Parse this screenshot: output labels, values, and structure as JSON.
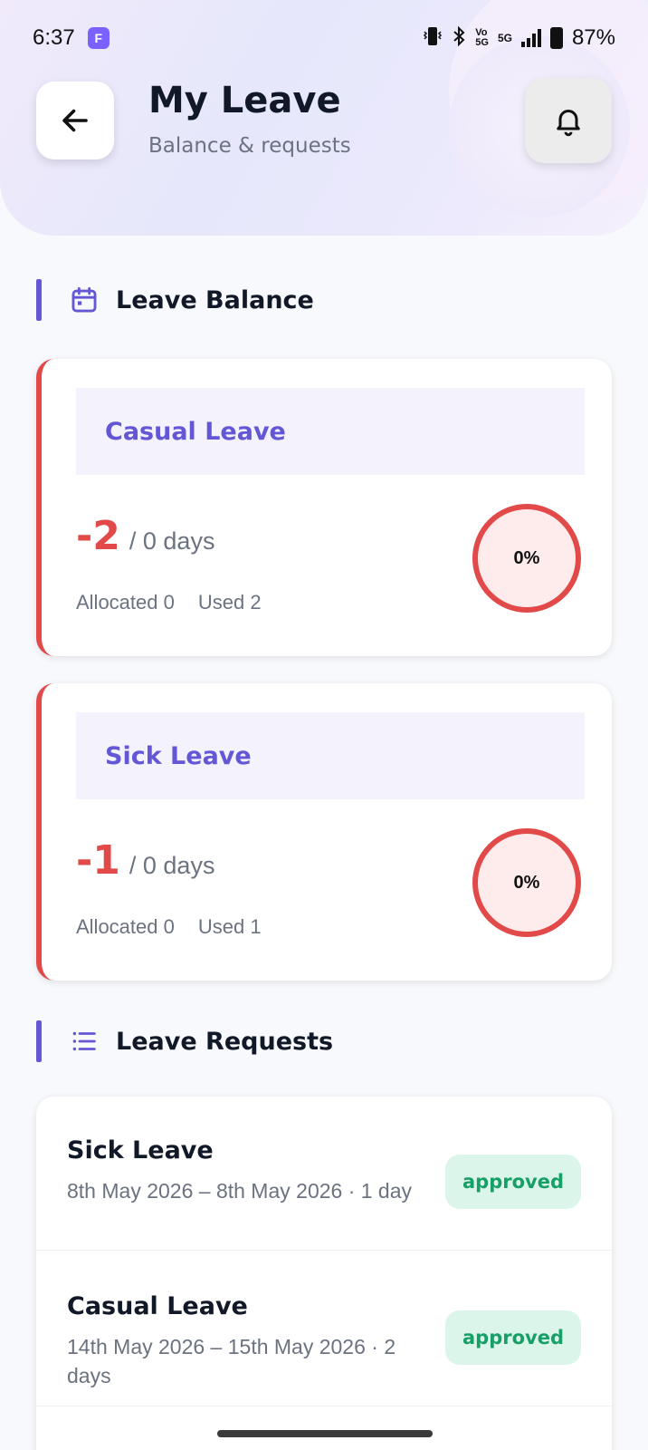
{
  "status_bar": {
    "time": "6:37",
    "battery": "87%",
    "network": "5G"
  },
  "header": {
    "title": "My Leave",
    "subtitle": "Balance & requests"
  },
  "sections": {
    "balance_title": "Leave Balance",
    "requests_title": "Leave Requests"
  },
  "balances": [
    {
      "type": "Casual Leave",
      "remaining": "-2",
      "total": "/ 0 days",
      "allocated": "Allocated 0",
      "used": "Used 2",
      "percent": "0%",
      "percent_value": 0
    },
    {
      "type": "Sick Leave",
      "remaining": "-1",
      "total": "/ 0 days",
      "allocated": "Allocated 0",
      "used": "Used 1",
      "percent": "0%",
      "percent_value": 0
    }
  ],
  "requests": [
    {
      "type": "Sick Leave",
      "dates": "8th May 2026 – 8th May 2026 · 1 day",
      "status": "approved"
    },
    {
      "type": "Casual Leave",
      "dates": "14th May 2026 – 15th May 2026 · 2 days",
      "status": "approved"
    }
  ],
  "icons": {
    "back": "arrow-left-icon",
    "notifications": "bell-icon",
    "balance": "calendar-icon",
    "requests": "list-icon"
  },
  "colors": {
    "accent": "#6357d6",
    "negative": "#e24a4a",
    "approved_bg": "#dcf5ea",
    "approved_text": "#17a066"
  }
}
